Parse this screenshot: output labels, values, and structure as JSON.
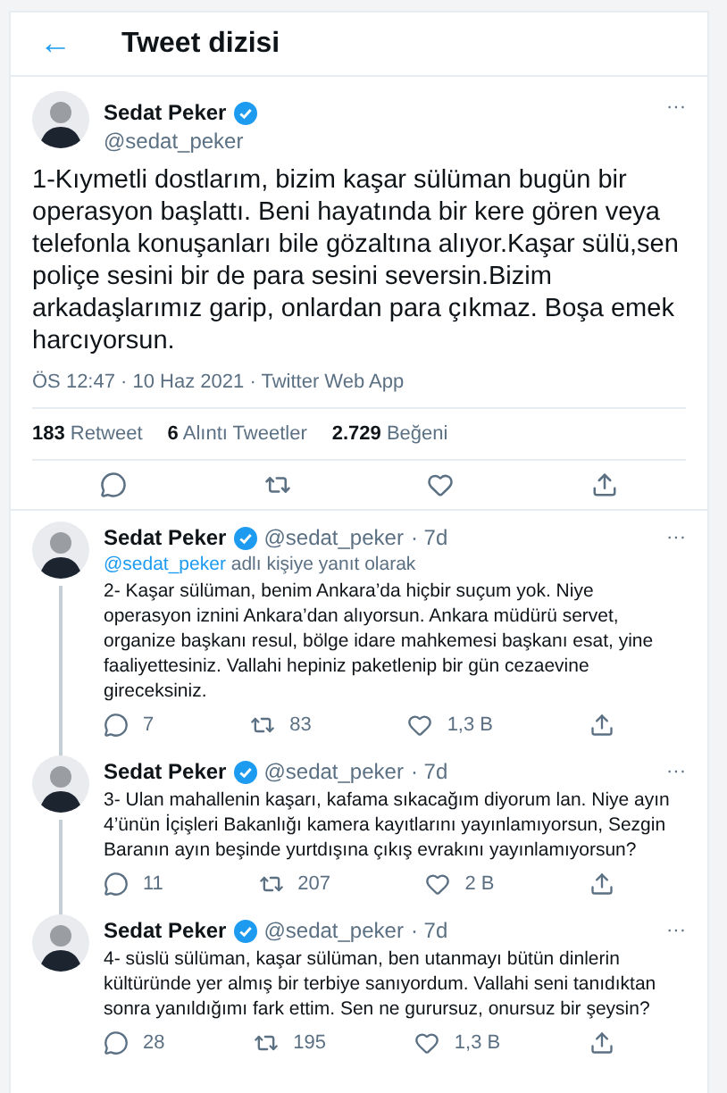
{
  "header": {
    "back": "←",
    "title": "Tweet dizisi"
  },
  "main_tweet": {
    "author": "Sedat Peker",
    "verified": true,
    "handle": "@sedat_peker",
    "more": "···",
    "text": "1-Kıymetli dostlarım, bizim kaşar sülüman bugün bir operasyon başlattı. Beni hayatında bir kere gören veya telefonla konuşanları bile gözaltına alıyor.Kaşar sülü,sen poliçe sesini bir de para sesini seversin.Bizim arkadaşlarımız garip, onlardan para çıkmaz. Boşa emek harcıyorsun.",
    "meta": "ÖS 12:47 · 10 Haz 2021 · Twitter Web App",
    "stats": [
      {
        "count": "183",
        "label": "Retweet"
      },
      {
        "count": "6",
        "label": "Alıntı Tweetler"
      },
      {
        "count": "2.729",
        "label": "Beğeni"
      }
    ]
  },
  "replies": [
    {
      "author": "Sedat Peker",
      "verified": true,
      "handle": "@sedat_peker",
      "time": "· 7d",
      "more": "···",
      "replying_to": {
        "handle": "@sedat_peker",
        "text": "adlı kişiye yanıt olarak"
      },
      "text": "2- Kaşar sülüman, benim Ankara’da hiçbir suçum yok. Niye operasyon iznini Ankara’dan alıyorsun. Ankara müdürü servet, organize başkanı resul, bölge idare mahkemesi başkanı esat, yine faaliyettesiniz. Vallahi hepiniz paketlenip bir gün cezaevine gireceksiniz.",
      "replies": "7",
      "retweets": "83",
      "likes": "1,3 B"
    },
    {
      "author": "Sedat Peker",
      "verified": true,
      "handle": "@sedat_peker",
      "time": "· 7d",
      "more": "···",
      "text": "3- Ulan mahallenin kaşarı, kafama sıkacağım diyorum lan. Niye ayın 4’ünün İçişleri Bakanlığı kamera kayıtlarını yayınlamıyorsun, Sezgin Baranın ayın beşinde yurtdışına çıkış evrakını yayınlamıyorsun?",
      "replies": "11",
      "retweets": "207",
      "likes": "2 B"
    },
    {
      "author": "Sedat Peker",
      "verified": true,
      "handle": "@sedat_peker",
      "time": "· 7d",
      "more": "···",
      "text": "4- süslü sülüman, kaşar sülüman, ben utanmayı bütün dinlerin kültüründe yer almış bir terbiye sanıyordum. Vallahi seni tanıdıktan sonra yanıldığımı fark ettim. Sen ne gurursuz, onursuz bir şeysin?",
      "replies": "28",
      "retweets": "195",
      "likes": "1,3 B"
    }
  ]
}
